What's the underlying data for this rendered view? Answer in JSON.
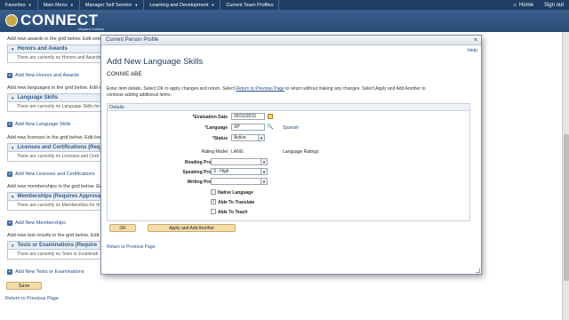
{
  "topnav": {
    "items": [
      "Favorites",
      "Main Menu",
      "Manager Self Service",
      "Learning and Development",
      "Current Team Profiles"
    ],
    "home": "Home",
    "signout": "Sign out"
  },
  "banner": {
    "logo_text": "CONNECT",
    "logo_sub": "Maryland Judiciary"
  },
  "background": {
    "awards_intro": "Add new awards in the grid below. Edit exis",
    "awards_header": "Honors and Awards",
    "awards_empty": "There are currently no Honors and Awards",
    "awards_add": "Add New Honors and Awards",
    "lang_intro": "Add new languages in the grid below. Edit e",
    "lang_header": "Language Skills",
    "lang_empty": "There are currently no Language Skills for",
    "lang_add": "Add New Language Skills",
    "lic_intro": "Add new licenses in the grid below. Edit lice",
    "lic_header": "Licenses and Certifications (Req",
    "lic_empty": "There are currently no Licenses and Certi",
    "lic_add": "Add New Licenses and Certifications",
    "mem_intro": "Add new memberships in the grid below. Ed",
    "mem_header": "Memberships (Requires Approva",
    "mem_empty": "There are currently no Memberships for th",
    "mem_add": "Add New Memberships",
    "test_intro": "Add new test results in the grid below. Edit",
    "test_header": "Tests or Examinations (Require",
    "test_empty": "There are currently no Tests or Examinati",
    "test_add": "Add New Tests or Examinations",
    "save": "Save",
    "return": "Return to Previous Page"
  },
  "modal": {
    "title": "Current Person Profile",
    "close": "×",
    "help": "Help",
    "heading": "Add New Language Skills",
    "person": "CONNIE ABE",
    "instr_1": "Enter item details. Select OK to apply changes and return. Select ",
    "instr_link": "Return to Previous Page",
    "instr_2": " to return without making any changes. Select Apply and Add Another to continue adding additional items.",
    "details_title": "Details",
    "eval_label": "*Evaluation Date",
    "eval_value": "05/31/2015",
    "lang_label": "*Language",
    "lang_value": "SP",
    "lang_desc": "Spanish",
    "status_label": "*Status",
    "status_value": "Active",
    "rating_label": "Rating Model",
    "rating_value": "LANG",
    "rating_desc": "Language Ratings",
    "reading_label": "Reading Proficiency",
    "reading_value": "",
    "speaking_label": "Speaking Proficiency",
    "speaking_value": "3 - High",
    "writing_label": "Writing Proficiency",
    "writing_value": "",
    "native_label": "Native Language",
    "native_checked": false,
    "translate_label": "Able To Translate",
    "translate_checked": true,
    "teach_label": "Able To Teach",
    "teach_checked": false,
    "ok": "OK",
    "apply": "Apply and Add Another",
    "return": "Return to Previous Page"
  }
}
